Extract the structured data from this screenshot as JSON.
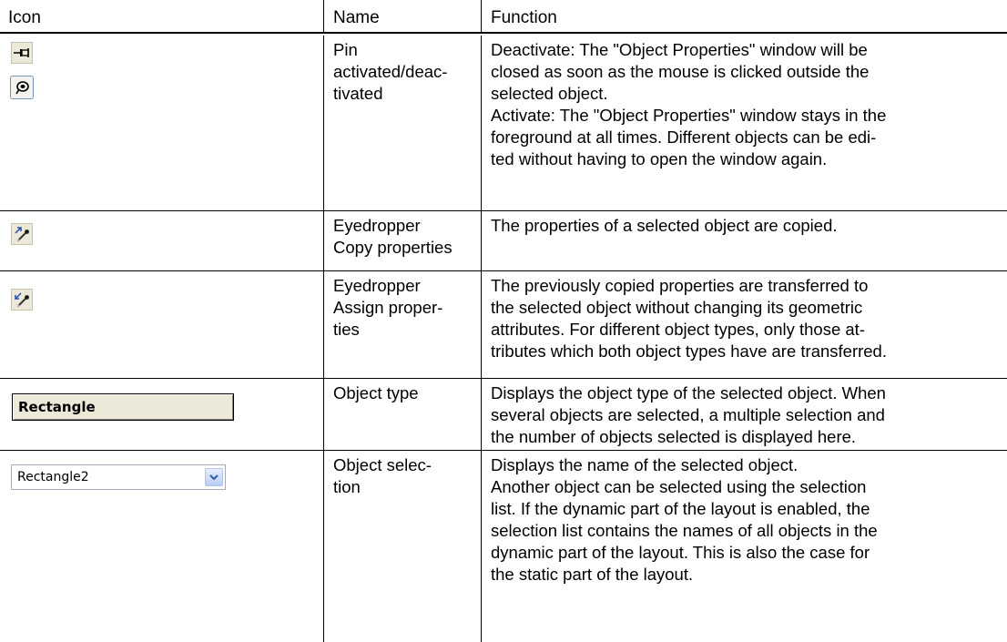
{
  "table": {
    "headers": {
      "icon": "Icon",
      "name": "Name",
      "function": "Function"
    },
    "rows": [
      {
        "name": "Pin\nactivated/deac-\ntivated",
        "function": "Deactivate: The \"Object Properties\" window will be\nclosed as soon as the mouse is clicked outside the\nselected object.\nActivate: The \"Object Properties\" window stays in the\nforeground at all times. Different objects can be edi-\nted without having to open the window again."
      },
      {
        "name": "Eyedropper\nCopy properties",
        "function": "The properties of a selected object are copied."
      },
      {
        "name": "Eyedropper\nAssign proper-\nties",
        "function": "The previously copied properties are transferred to\nthe selected object without changing its geometric\nattributes. For different object types, only those at-\ntributes which both object types have are transferred."
      },
      {
        "name": "Object type",
        "function": "Displays the object type of the selected object. When\nseveral objects are selected, a multiple selection and\nthe number of objects selected is displayed here.",
        "icon_text": "Rectangle"
      },
      {
        "name": "Object selec-\ntion",
        "function": "Displays the name of the selected object.\nAnother object can be selected using the selection\nlist. If the dynamic part of the layout is enabled, the\nselection list contains the names of all objects in the\ndynamic part of the layout. This is also the case for\nthe static part of the layout.",
        "icon_text": "Rectangle2"
      }
    ]
  },
  "icons": {
    "row1_a": "pin-deactivated-icon",
    "row1_b": "pin-activated-icon",
    "row2": "eyedropper-copy-icon",
    "row3": "eyedropper-assign-icon",
    "row5_arrow": "chevron-down-icon"
  }
}
